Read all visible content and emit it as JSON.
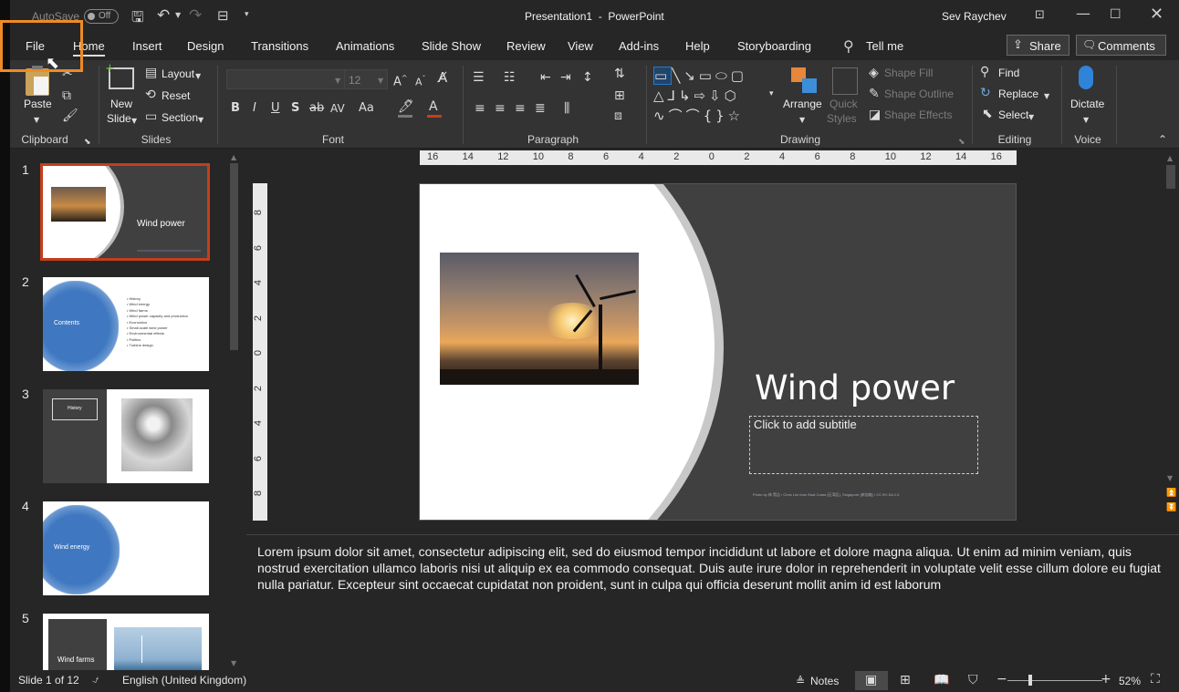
{
  "titlebar": {
    "autosave_label": "AutoSave",
    "autosave_state": "Off",
    "title": "Presentation1  -  PowerPoint",
    "user": "Sev Raychev"
  },
  "tabs": [
    "File",
    "Home",
    "Insert",
    "Design",
    "Transitions",
    "Animations",
    "Slide Show",
    "Review",
    "View",
    "Add-ins",
    "Help",
    "Storyboarding",
    "Tell me"
  ],
  "share_label": "Share",
  "comments_label": "Comments",
  "ribbon": {
    "clipboard": {
      "label": "Clipboard",
      "paste": "Paste"
    },
    "slides": {
      "label": "Slides",
      "new_slide_1": "New",
      "new_slide_2": "Slide",
      "layout": "Layout",
      "reset": "Reset",
      "section": "Section"
    },
    "font": {
      "label": "Font",
      "size": "12",
      "B": "B",
      "I": "I",
      "U": "U",
      "S": "S",
      "abc": "ab",
      "AV": "AV",
      "Aa": "Aa"
    },
    "paragraph": {
      "label": "Paragraph"
    },
    "drawing": {
      "label": "Drawing",
      "arrange": "Arrange",
      "quick_1": "Quick",
      "quick_2": "Styles",
      "shape_fill": "Shape Fill",
      "shape_outline": "Shape Outline",
      "shape_effects": "Shape Effects"
    },
    "editing": {
      "label": "Editing",
      "find": "Find",
      "replace": "Replace",
      "select": "Select"
    },
    "voice": {
      "label": "Voice",
      "dictate": "Dictate"
    }
  },
  "thumbnails": [
    {
      "num": "1",
      "title": "Wind power"
    },
    {
      "num": "2",
      "title": "Contents",
      "bullets": [
        "History",
        "Wind energy",
        "Wind farms",
        "Wind power capacity and production",
        "Economics",
        "Small-scale wind power",
        "Environmental effects",
        "Politics",
        "Turbine design"
      ]
    },
    {
      "num": "3",
      "title": "History"
    },
    {
      "num": "4",
      "title": "Wind energy"
    },
    {
      "num": "5",
      "title": "Wind farms"
    }
  ],
  "slide": {
    "title": "Wind power",
    "subtitle_placeholder": "Click to add subtitle",
    "credit": "Photo by 林 賢吉 / Chris Lim from East Coast (石湾区), Singapore (新加坡) / CC BY-SA 2.0"
  },
  "ruler_h": [
    "16",
    "14",
    "12",
    "10",
    "8",
    "6",
    "4",
    "2",
    "0",
    "2",
    "4",
    "6",
    "8",
    "10",
    "12",
    "14",
    "16"
  ],
  "ruler_v": [
    "8",
    "6",
    "4",
    "2",
    "0",
    "2",
    "4",
    "6",
    "8"
  ],
  "notes": "Lorem ipsum dolor sit amet, consectetur adipiscing elit, sed do eiusmod tempor incididunt ut labore et dolore magna aliqua. Ut enim ad minim veniam, quis nostrud exercitation ullamco laboris nisi ut aliquip ex ea commodo consequat. Duis aute irure dolor in reprehenderit in voluptate velit esse cillum dolore eu fugiat nulla pariatur. Excepteur sint occaecat cupidatat non proident, sunt in culpa qui officia deserunt mollit anim id est laborum",
  "status": {
    "slide": "Slide 1 of 12",
    "language": "English (United Kingdom)",
    "notes": "Notes",
    "zoom": "52%"
  },
  "colors": {
    "accent": "#c43e1c",
    "highlight": "#f08a24",
    "slide_dark": "#404040"
  }
}
